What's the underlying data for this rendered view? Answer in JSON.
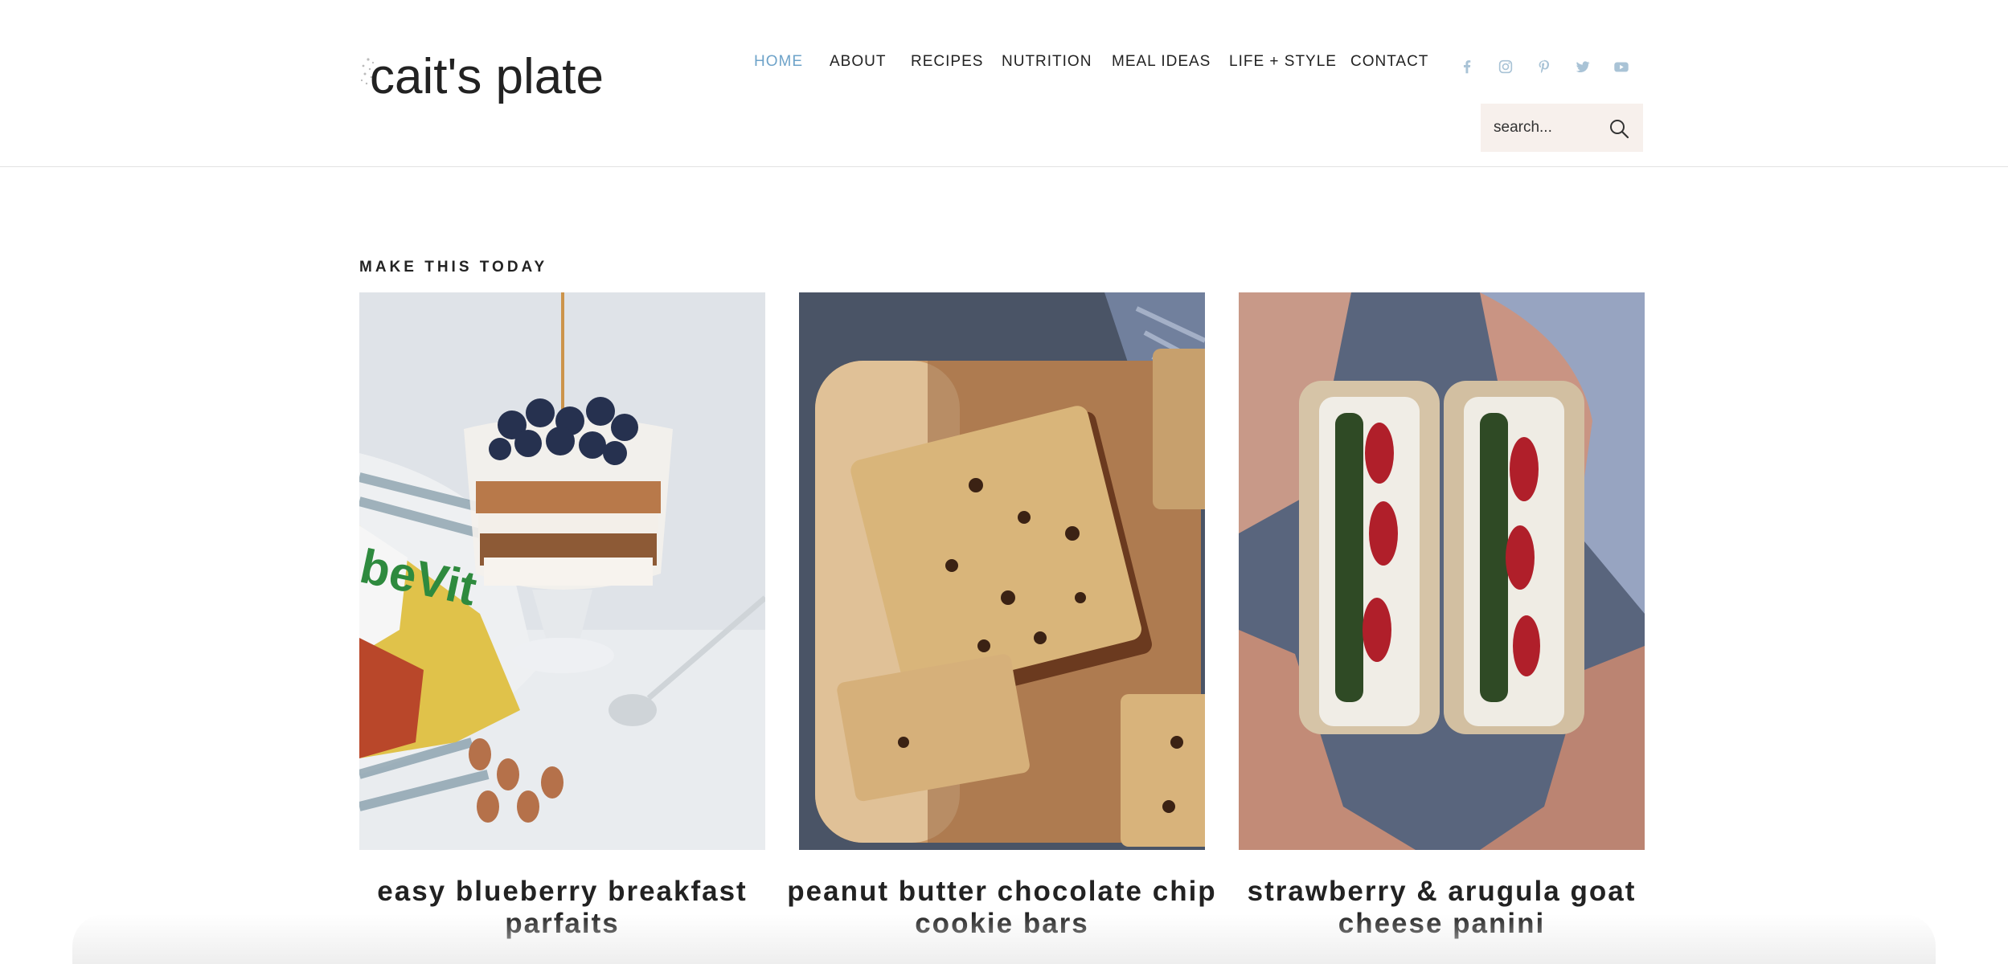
{
  "header": {
    "logo_text": "cait's plate",
    "nav": [
      {
        "label": "HOME",
        "active": true
      },
      {
        "label": "ABOUT",
        "active": false
      },
      {
        "label": "RECIPES",
        "active": false
      },
      {
        "label": "NUTRITION",
        "active": false
      },
      {
        "label": "MEAL IDEAS",
        "active": false
      },
      {
        "label": "LIFE + STYLE",
        "active": false
      },
      {
        "label": "CONTACT",
        "active": false
      }
    ],
    "social_icons": [
      "facebook-icon",
      "instagram-icon",
      "pinterest-icon",
      "twitter-icon",
      "youtube-icon"
    ],
    "search": {
      "placeholder": "search..."
    }
  },
  "colors": {
    "accent": "#6ea3c9",
    "text": "#222222",
    "social": "#a9c3d6",
    "search_bg": "#f7f0ec",
    "divider": "#e3e3e3"
  },
  "section": {
    "title": "MAKE THIS TODAY",
    "cards": [
      {
        "title": "easy blueberry breakfast parfaits",
        "image": "blueberry-parfait-photo"
      },
      {
        "title": "peanut butter chocolate chip cookie bars",
        "image": "cookie-bars-photo"
      },
      {
        "title": "strawberry & arugula goat cheese panini",
        "image": "panini-photo"
      }
    ]
  }
}
